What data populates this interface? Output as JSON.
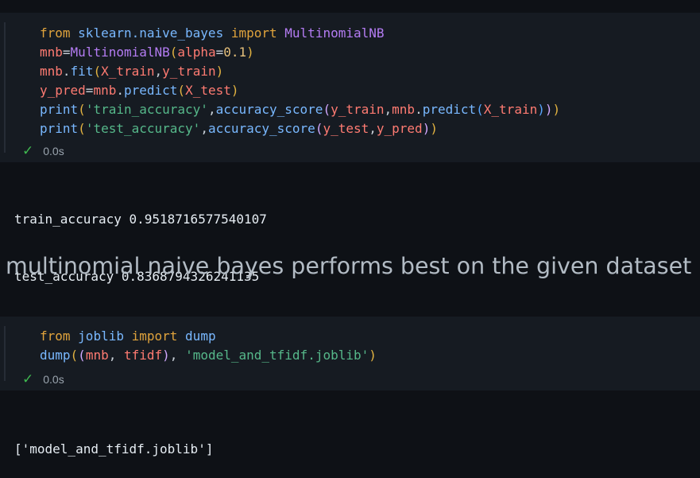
{
  "cell1": {
    "lines": [
      [
        [
          "kw",
          "from"
        ],
        [
          "op",
          " "
        ],
        [
          "id",
          "sklearn.naive_bayes"
        ],
        [
          "op",
          " "
        ],
        [
          "kw",
          "import"
        ],
        [
          "op",
          " "
        ],
        [
          "cls",
          "MultinomialNB"
        ]
      ],
      [
        [
          "var",
          "mnb"
        ],
        [
          "op",
          "="
        ],
        [
          "cls",
          "MultinomialNB"
        ],
        [
          "pn",
          "("
        ],
        [
          "var",
          "alpha"
        ],
        [
          "op",
          "="
        ],
        [
          "num",
          "0.1"
        ],
        [
          "pn",
          ")"
        ]
      ],
      [
        [
          "var",
          "mnb"
        ],
        [
          "op",
          "."
        ],
        [
          "id",
          "fit"
        ],
        [
          "pn",
          "("
        ],
        [
          "var",
          "X_train"
        ],
        [
          "op",
          ","
        ],
        [
          "var",
          "y_train"
        ],
        [
          "pn",
          ")"
        ]
      ],
      [
        [
          "var",
          "y_pred"
        ],
        [
          "op",
          "="
        ],
        [
          "var",
          "mnb"
        ],
        [
          "op",
          "."
        ],
        [
          "id",
          "predict"
        ],
        [
          "pn",
          "("
        ],
        [
          "var",
          "X_test"
        ],
        [
          "pn",
          ")"
        ]
      ],
      [
        [
          "id",
          "print"
        ],
        [
          "pn",
          "("
        ],
        [
          "str",
          "'train_accuracy'"
        ],
        [
          "op",
          ","
        ],
        [
          "id",
          "accuracy_score"
        ],
        [
          "pn2",
          "("
        ],
        [
          "var",
          "y_train"
        ],
        [
          "op",
          ","
        ],
        [
          "var",
          "mnb"
        ],
        [
          "op",
          "."
        ],
        [
          "id",
          "predict"
        ],
        [
          "pn3",
          "("
        ],
        [
          "var",
          "X_train"
        ],
        [
          "pn3",
          ")"
        ],
        [
          "pn2",
          ")"
        ],
        [
          "pn",
          ")"
        ]
      ],
      [
        [
          "id",
          "print"
        ],
        [
          "pn",
          "("
        ],
        [
          "str",
          "'test_accuracy'"
        ],
        [
          "op",
          ","
        ],
        [
          "id",
          "accuracy_score"
        ],
        [
          "pn2",
          "("
        ],
        [
          "var",
          "y_test"
        ],
        [
          "op",
          ","
        ],
        [
          "var",
          "y_pred"
        ],
        [
          "pn2",
          ")"
        ],
        [
          "pn",
          ")"
        ]
      ]
    ],
    "status_time": "0.0s",
    "output": [
      "train_accuracy 0.9518716577540107",
      "test_accuracy 0.8368794326241135"
    ]
  },
  "markdown": {
    "text": "multinomial naive bayes performs best on the given dataset"
  },
  "cell2": {
    "lines": [
      [
        [
          "kw",
          "from"
        ],
        [
          "op",
          " "
        ],
        [
          "id",
          "joblib"
        ],
        [
          "op",
          " "
        ],
        [
          "kw",
          "import"
        ],
        [
          "op",
          " "
        ],
        [
          "id",
          "dump"
        ]
      ],
      [
        [
          "id",
          "dump"
        ],
        [
          "pn",
          "("
        ],
        [
          "pn2",
          "("
        ],
        [
          "var",
          "mnb"
        ],
        [
          "op",
          ", "
        ],
        [
          "var",
          "tfidf"
        ],
        [
          "pn2",
          ")"
        ],
        [
          "op",
          ", "
        ],
        [
          "str",
          "'model_and_tfidf.joblib'"
        ],
        [
          "pn",
          ")"
        ]
      ]
    ],
    "status_time": "0.0s",
    "output": [
      "['model_and_tfidf.joblib']"
    ]
  },
  "icons": {
    "status_ok": "checkmark-icon",
    "ok_color": "#3fb950"
  }
}
